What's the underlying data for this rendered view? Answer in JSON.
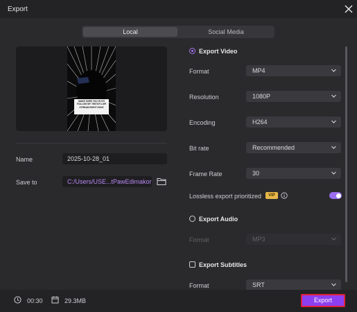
{
  "window": {
    "title": "Export"
  },
  "tabs": [
    {
      "label": "Local",
      "active": true
    },
    {
      "label": "Social Media",
      "active": false
    }
  ],
  "preview": {
    "banner_lines": [
      "MAKE SURE YOU GUYS",
      "FOLLOW MY TWITCH LIVE",
      "STREAM RIGHT NOW!"
    ]
  },
  "name": {
    "label": "Name",
    "value": "2025-10-28_01"
  },
  "save_to": {
    "label": "Save to",
    "value": "C:/Users/USE...tPawEdimakor"
  },
  "export_video": {
    "label": "Export Video",
    "selected": true,
    "rows": [
      {
        "label": "Format",
        "value": "MP4"
      },
      {
        "label": "Resolution",
        "value": "1080P"
      },
      {
        "label": "Encoding",
        "value": "H264"
      },
      {
        "label": "Bit rate",
        "value": "Recommended"
      },
      {
        "label": "Frame Rate",
        "value": "30"
      }
    ],
    "lossless_label": "Lossless export prioritized",
    "vip_badge": "VIP",
    "lossless_enabled": true
  },
  "export_audio": {
    "label": "Export Audio",
    "selected": false,
    "format_label": "Format",
    "format_value": "MP3"
  },
  "export_subtitles": {
    "label": "Export Subtitles",
    "checked": false,
    "format_label": "Format",
    "format_value": "SRT"
  },
  "footer": {
    "duration": "00:30",
    "file_size": "29.3MB",
    "export_label": "Export"
  },
  "colors": {
    "accent": "#8c3ff0",
    "highlight_border": "#e2203a",
    "vip": "#e6b84a",
    "path_text": "#b989f3"
  }
}
